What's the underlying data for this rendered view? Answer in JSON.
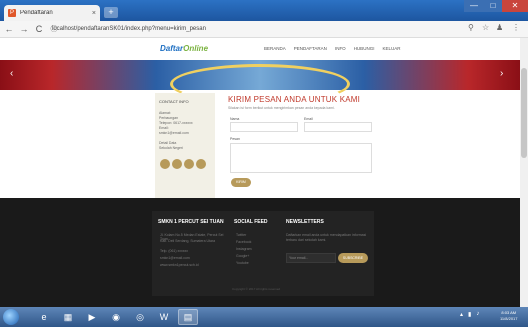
{
  "browser": {
    "tab_title": "Pendaftaran",
    "tab_close": "×",
    "new_tab": "+",
    "url": "localhost/pendaftaranSK01/index.php?menu=kirim_pesan",
    "win_min": "—",
    "win_max": "□",
    "win_close": "✕"
  },
  "site": {
    "logo_main": "Daftar",
    "logo_accent": "Online",
    "nav": [
      "BERANDA",
      "PENDAFTARAN",
      "INFO",
      "HUBUNGI",
      "KELUAR"
    ]
  },
  "contact_card": {
    "title": "CONTACT INFO",
    "lines": [
      "Alamat:",
      "Perbaungan",
      "Telepon: 0617-xxxxxx",
      "Email:",
      "smkn1@email.com"
    ],
    "detail_title": "Detail Data",
    "detail_value": "Sekolah Negeri"
  },
  "form": {
    "title": "KIRIM PESAN ANDA UNTUK KAMI",
    "subtitle": "Silakan isi form berikut untuk mengirimkan pesan anda kepada kami.",
    "name_label": "Nama",
    "email_label": "Email",
    "message_label": "Pesan",
    "send_label": "KIRIM"
  },
  "footer": {
    "col1_title": "SMKN 1 PERCUT SEI TUAN",
    "col1_items": [
      "Jl. Kolam No.5 Medan Estate, Percut Sei Tuan",
      "Kab. Deli Serdang, Sumatera Utara",
      "Telp. (061) xxxxxx",
      "smkn1@email.com",
      "www.smkn1percut.sch.id"
    ],
    "col2_title": "SOCIAL FEED",
    "col2_items": [
      "Twitter",
      "Facebook",
      "Instagram",
      "Google+",
      "Youtube"
    ],
    "col3_title": "NEWSLETTERS",
    "col3_text": "Daftarkan email anda untuk mendapatkan informasi terbaru dari sekolah kami.",
    "nl_placeholder": "Your email...",
    "nl_button": "SUBSCRIBE",
    "copyright": "Copyright © 2017 All rights reserved"
  },
  "taskbar": {
    "clock_time": "8:03 AM",
    "clock_date": "11/8/2017"
  },
  "colors": {
    "accent": "#b79a5a",
    "title_red": "#c0392b",
    "footer_bg": "#1a1a1a"
  }
}
